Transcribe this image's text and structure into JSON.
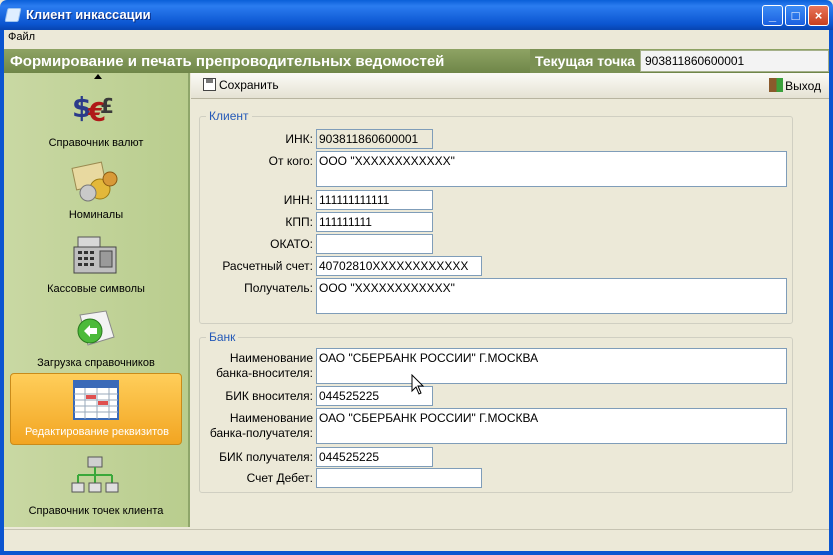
{
  "window": {
    "title": "Клиент инкассации",
    "minimize": "_",
    "maximize": "□",
    "close": "×"
  },
  "menu": {
    "file": "Файл"
  },
  "header": {
    "title": "Формирование и печать препроводительных ведомостей",
    "point_label": "Текущая точка",
    "point_value": "903811860600001"
  },
  "sidebar": {
    "items": [
      {
        "label": "Справочник валют",
        "icon": "currency-icon"
      },
      {
        "label": "Номиналы",
        "icon": "coins-icon"
      },
      {
        "label": "Кассовые символы",
        "icon": "cash-register-icon"
      },
      {
        "label": "Загрузка справочников",
        "icon": "download-icon"
      },
      {
        "label": "Редактирование реквизитов",
        "icon": "table-icon",
        "active": true
      },
      {
        "label": "Справочник точек клиента",
        "icon": "network-icon"
      }
    ]
  },
  "toolbar": {
    "save_label": "Сохранить",
    "exit_label": "Выход"
  },
  "client": {
    "group_title": "Клиент",
    "ink_label": "ИНК:",
    "ink_value": "903811860600001",
    "from_label": "От кого:",
    "from_value": "ООО \"XXXXXXXXXXXX\"",
    "inn_label": "ИНН:",
    "inn_value": "111111111111",
    "kpp_label": "КПП:",
    "kpp_value": "111111111",
    "okato_label": "ОКАТО:",
    "okato_value": "",
    "account_label": "Расчетный счет:",
    "account_value": "40702810XXXXXXXXXXXX",
    "recipient_label": "Получатель:",
    "recipient_value": "ООО \"XXXXXXXXXXXX\""
  },
  "bank": {
    "group_title": "Банк",
    "sender_bank_label": "Наименование\nбанка-вносителя:",
    "sender_bank_value": "ОАО \"СБЕРБАНК РОССИИ\" Г.МОСКВА",
    "sender_bik_label": "БИК вносителя:",
    "sender_bik_value": "044525225",
    "recipient_bank_label": "Наименование\nбанка-получателя:",
    "recipient_bank_value": "ОАО \"СБЕРБАНК РОССИИ\" Г.МОСКВА",
    "recipient_bik_label": "БИК получателя:",
    "recipient_bik_value": "044525225",
    "debit_label": "Счет Дебет:",
    "debit_value": ""
  }
}
